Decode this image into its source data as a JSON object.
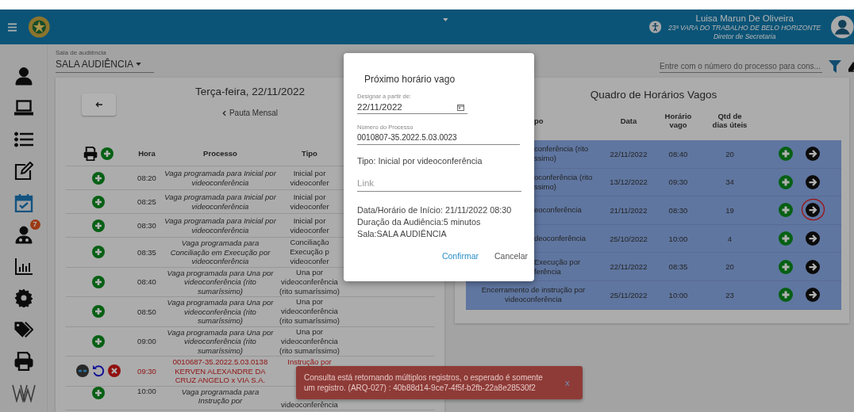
{
  "top_bar": {
    "user_name": "Luisa Marun De Oliveira",
    "unit": "23ª VARA DO TRABALHO DE BELO HORIZONTE",
    "role": "Diretor de Secretaria"
  },
  "sidebar": {
    "items": [
      {
        "kind": "person",
        "selected": false
      },
      {
        "kind": "laptop",
        "selected": false
      },
      {
        "kind": "list",
        "selected": false
      },
      {
        "kind": "edit",
        "selected": false
      },
      {
        "kind": "calendar",
        "selected": true
      },
      {
        "kind": "group",
        "selected": false,
        "badge": "7"
      },
      {
        "kind": "chart",
        "selected": false
      },
      {
        "kind": "gear",
        "selected": false
      },
      {
        "kind": "tags",
        "selected": false
      },
      {
        "kind": "printer",
        "selected": false
      },
      {
        "kind": "logo",
        "selected": false
      }
    ]
  },
  "room_select": {
    "label": "Sala de audiência",
    "value": "SALA AUDIÊNCIA"
  },
  "search": {
    "placeholder": "Entre com o número do processo para cons..."
  },
  "schedule": {
    "date_title": "Terça-feira, 22/11/2022",
    "monthly_link": "Pauta Mensal",
    "columns": [
      "Hora",
      "Processo",
      "Tipo"
    ],
    "rows": [
      {
        "kind": "vacancy",
        "time": "08:20",
        "process": "Vaga programada para Inicial por videoconferência",
        "type": "Inicial por\nvideoconfer"
      },
      {
        "kind": "vacancy",
        "time": "08:25",
        "process": "Vaga programada para Inicial por videoconferência",
        "type": "Inicial por\nvideoconfer"
      },
      {
        "kind": "vacancy",
        "time": "08:30",
        "process": "Vaga programada para Inicial por videoconferência",
        "type": "Inicial por\nvideoconfer"
      },
      {
        "kind": "vacancy",
        "time": "08:35",
        "process": "Vaga programada para Conciliação em Execução por videoconferência",
        "type": "Conciliação\nExecução p\nvideoconfer"
      },
      {
        "kind": "vacancy",
        "time": "08:40",
        "process": "Vaga programada para Una por videoconferência (rito sumaríssimo)",
        "type": "Una por\nvideoconferência\n(rito sumaríssimo)"
      },
      {
        "kind": "vacancy",
        "time": "08:50",
        "process": "Vaga programada para Una por videoconferência (rito sumaríssimo)",
        "type": "Una por\nvideoconferência\n(rito sumaríssimo)"
      },
      {
        "kind": "vacancy",
        "time": "09:00",
        "process": "Vaga programada para Una por videoconferência (rito sumaríssimo)",
        "type": "Una por\nvideoconferência\n(rito sumaríssimo)"
      },
      {
        "kind": "booked",
        "time": "09:30",
        "process": "0010687-35.2022.5.03.0138\nKERVEN ALEXANDRE DA\nCRUZ ANGELO x VIA S.A.",
        "type": "Instrução por"
      },
      {
        "kind": "vacancy",
        "time": "10:00",
        "process": "Vaga programada para\nInstrução por",
        "type": "videoconferência"
      }
    ]
  },
  "free_slots": {
    "title": "Quadro de Horários Vagos",
    "columns": [
      "po",
      "Data",
      "Horário vago",
      "Qtd de dias úteis"
    ],
    "rows": [
      {
        "kind": "partial",
        "type": "conferência (rito\nssimo)",
        "date": "22/11/2022",
        "time": "08:40",
        "days": "20",
        "circled": false
      },
      {
        "kind": "partial",
        "type": "oconferência (rito\nssimo)",
        "date": "13/12/2022",
        "time": "09:30",
        "days": "34",
        "circled": false
      },
      {
        "kind": "partial",
        "type": "eoconferência",
        "date": "21/11/2022",
        "time": "08:30",
        "days": "19",
        "circled": true
      },
      {
        "kind": "partial",
        "type": "deoconferência",
        "date": "25/10/2022",
        "time": "10:00",
        "days": "4",
        "circled": false
      },
      {
        "kind": "partial",
        "type": "Execução por\nferência",
        "date": "22/11/2022",
        "time": "08:35",
        "days": "20",
        "circled": false
      },
      {
        "kind": "full",
        "type": "Encerramento de instrução por\nvideoconferência",
        "date": "25/11/2022",
        "time": "10:00",
        "days": "23",
        "circled": false
      }
    ]
  },
  "dialog": {
    "title": "Próximo horário vago",
    "date_label": "Designar a partir de:",
    "date_value": "22/11/2022",
    "process_label": "Número do Processo",
    "process_value": "0010807-35.2022.5.03.0023",
    "type_text": "Tipo: Inicial por videoconferência",
    "link_placeholder": "Link",
    "info": [
      "Data/Horário de Início: 21/11/2022 08:30",
      "Duração da Audiência:5 minutos",
      "Sala:SALA AUDIÊNCIA"
    ],
    "confirm": "Confirmar",
    "cancel": "Cancelar"
  },
  "toast": {
    "message": "Consulta está retornando múltiplos registros, o esperado é somente um registro. (ARQ-027) : 40b88d14-9ce7-4f5f-b2fb-22a8e28530f2",
    "close": "x"
  }
}
